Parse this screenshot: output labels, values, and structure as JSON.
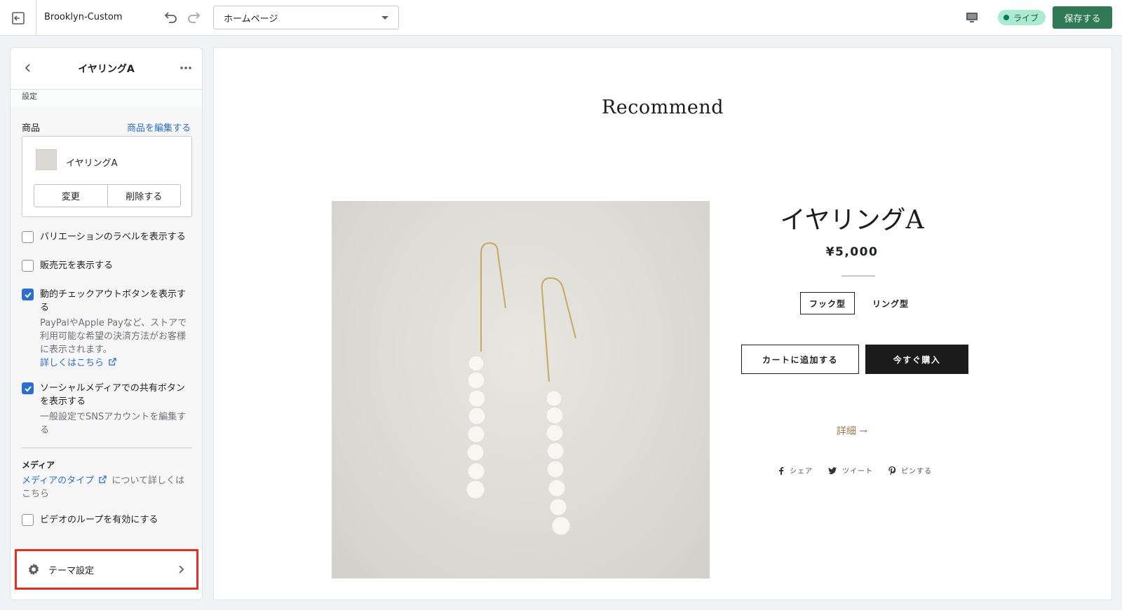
{
  "topbar": {
    "theme_name": "Brooklyn-Custom",
    "page_select": "ホームページ",
    "live_label": "ライブ",
    "save_label": "保存する"
  },
  "sidebar": {
    "title": "イヤリングA",
    "section_caption": "設定",
    "product_label": "商品",
    "edit_product_link": "商品を編集する",
    "selected_product": "イヤリングA",
    "change_button": "変更",
    "remove_button": "削除する",
    "checkboxes": [
      {
        "label": "バリエーションのラベルを表示する",
        "checked": false
      },
      {
        "label": "販売元を表示する",
        "checked": false
      },
      {
        "label": "動的チェックアウトボタンを表示する",
        "checked": true
      },
      {
        "label": "ソーシャルメディアでの共有ボタンを表示する",
        "checked": true
      }
    ],
    "dynamic_help": "PayPalやApple Payなど、ストアで利用可能な希望の決済方法がお客様に表示されます。",
    "learn_more_link": "詳しくはこちら",
    "social_help": "一般設定でSNSアカウントを編集する",
    "media_title": "メディア",
    "media_link": "メディアのタイプ",
    "media_text": "について詳しくはこちら",
    "video_loop_label": "ビデオのループを有効にする",
    "theme_settings_label": "テーマ設定"
  },
  "preview": {
    "heading": "Recommend",
    "product_title": "イヤリングA",
    "price": "¥5,000",
    "variants": [
      "フック型",
      "リング型"
    ],
    "add_to_cart": "カートに追加する",
    "buy_now": "今すぐ購入",
    "details_link": "詳細 →",
    "share": [
      "シェア",
      "ツイート",
      "ピンする"
    ]
  },
  "colors": {
    "save_button": "#2f7a55",
    "live_badge": "#aee9d1",
    "checkbox_checked": "#2c6ecb",
    "highlight_border": "#e0301e",
    "details_link": "#a3794a"
  }
}
